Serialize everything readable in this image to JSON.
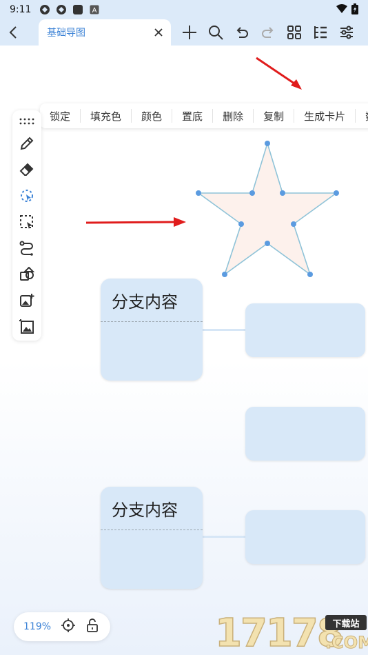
{
  "status_bar": {
    "time": "9:11"
  },
  "header": {
    "tab_title": "基础导图"
  },
  "context_menu": {
    "items": [
      "锁定",
      "填充色",
      "颜色",
      "置底",
      "删除",
      "复制",
      "生成卡片",
      "数"
    ]
  },
  "nodes": {
    "branch_1": "分支内容",
    "branch_2": "分支内容"
  },
  "zoom": {
    "level": "119%"
  },
  "watermark": {
    "number": "17178",
    "badge": "下载站",
    "domain": ".COM"
  },
  "colors": {
    "accent": "#3b82d6",
    "node_fill": "#d8e8f8",
    "star_fill": "#fdf1ec",
    "star_stroke": "#8fc3d8",
    "arrow": "#e01c1c",
    "header_bg": "#dceaf9"
  },
  "icons": {
    "toolbar_left": [
      "more-dots-icon",
      "pen-icon",
      "eraser-icon",
      "lasso-select-icon",
      "selection-box-icon",
      "connector-icon",
      "shape-icon",
      "image-add-icon",
      "image-icon"
    ],
    "header_tools": [
      "add-icon",
      "search-icon",
      "undo-icon",
      "redo-icon",
      "grid-icon",
      "outline-icon",
      "settings-sliders-icon"
    ]
  }
}
